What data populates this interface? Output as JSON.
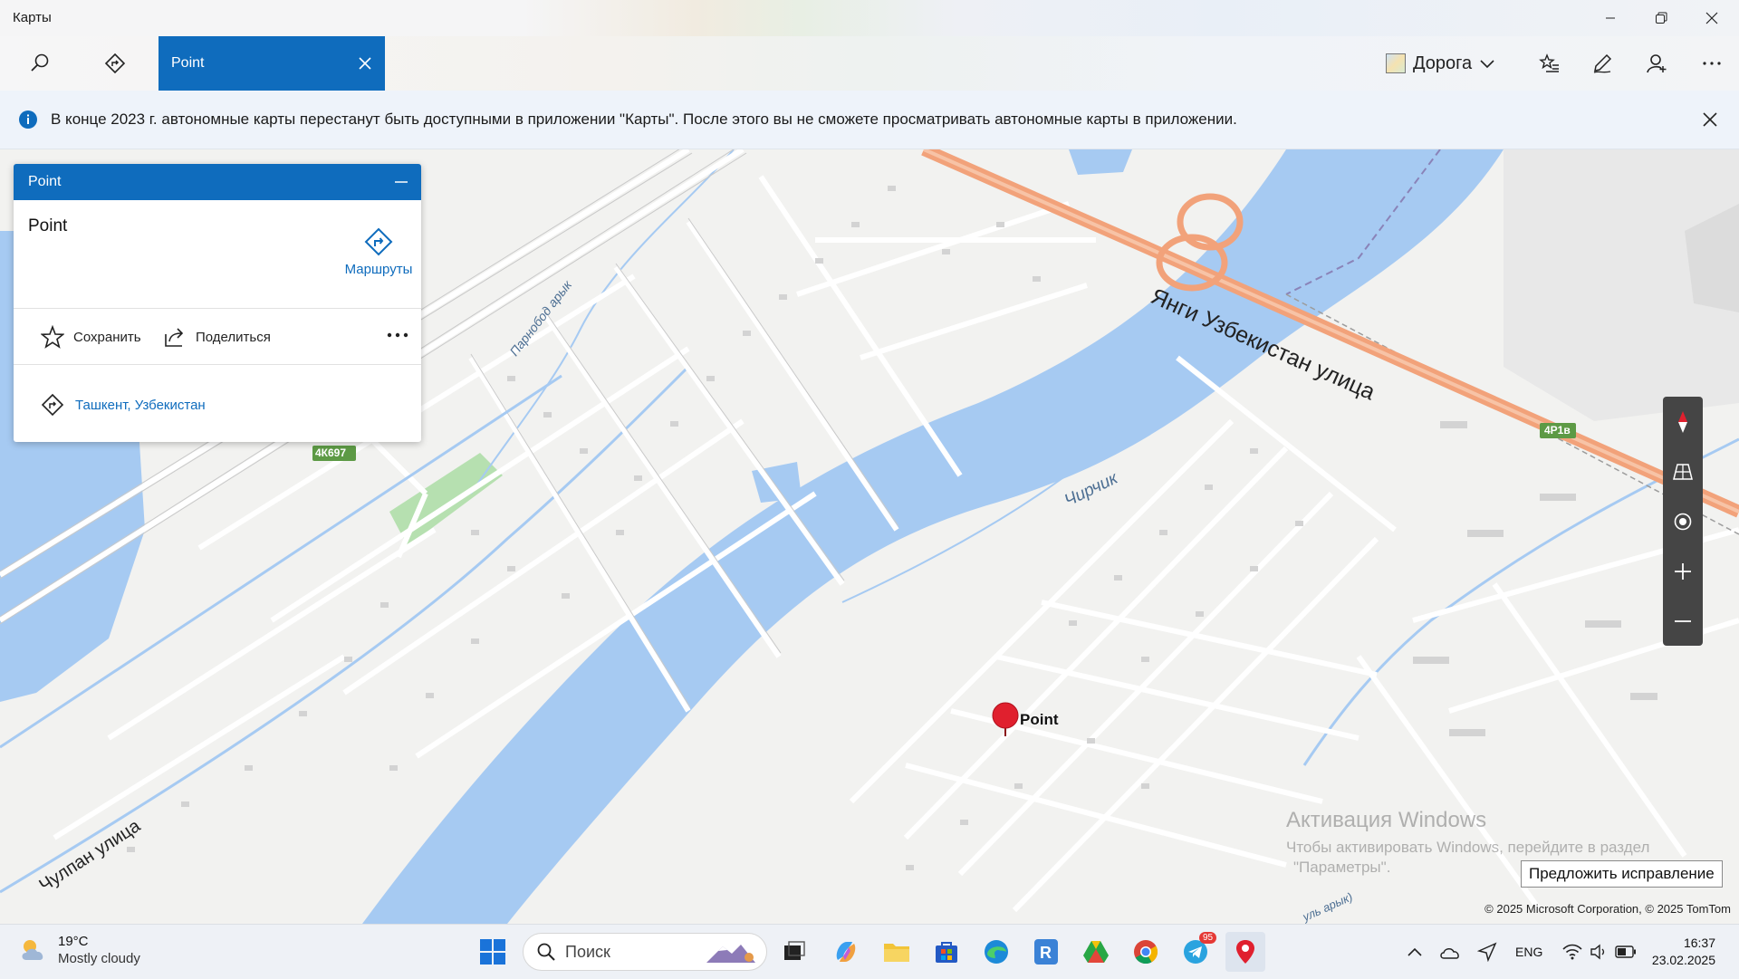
{
  "window": {
    "title": "Карты"
  },
  "toolbar": {
    "active_tab_label": "Point",
    "map_style_label": "Дорога"
  },
  "notice": {
    "text": "В конце 2023 г. автономные карты перестанут быть доступными в приложении \"Карты\". После этого вы не сможете просматривать автономные карты в приложении."
  },
  "panel": {
    "header_title": "Point",
    "place_name": "Point",
    "routes_label": "Маршруты",
    "save_label": "Сохранить",
    "share_label": "Поделиться",
    "location_text": "Ташкент, Узбекистан"
  },
  "map": {
    "labels": {
      "street_main": "Янги Узбекистан улица",
      "street_chulpan": "Чулпан улица",
      "river": "Чирчик",
      "canal": "Парнобод арык",
      "canal_bottom": "уль арык)",
      "road_badge_1": "4К697",
      "road_badge_2": "4Р1в",
      "pin_label": "Point"
    },
    "suggest_label": "Предложить исправление",
    "copyright": "© 2025 Microsoft Corporation, © 2025 TomTom",
    "watermark_title": "Активация Windows",
    "watermark_line1": "Чтобы активировать Windows, перейдите в раздел",
    "watermark_line2": "\"Параметры\".",
    "colors": {
      "water": "#a6caf2",
      "highway": "#f2a27a",
      "road_badge": "#5d9a45",
      "pin": "#e0202e",
      "park": "#b6e0b0"
    }
  },
  "taskbar": {
    "weather_temp": "19°C",
    "weather_desc": "Mostly cloudy",
    "search_placeholder": "Поиск",
    "telegram_badge": "95",
    "language": "ENG",
    "time": "16:37",
    "date": "23.02.2025"
  },
  "colors": {
    "accent": "#0f6cbd"
  }
}
